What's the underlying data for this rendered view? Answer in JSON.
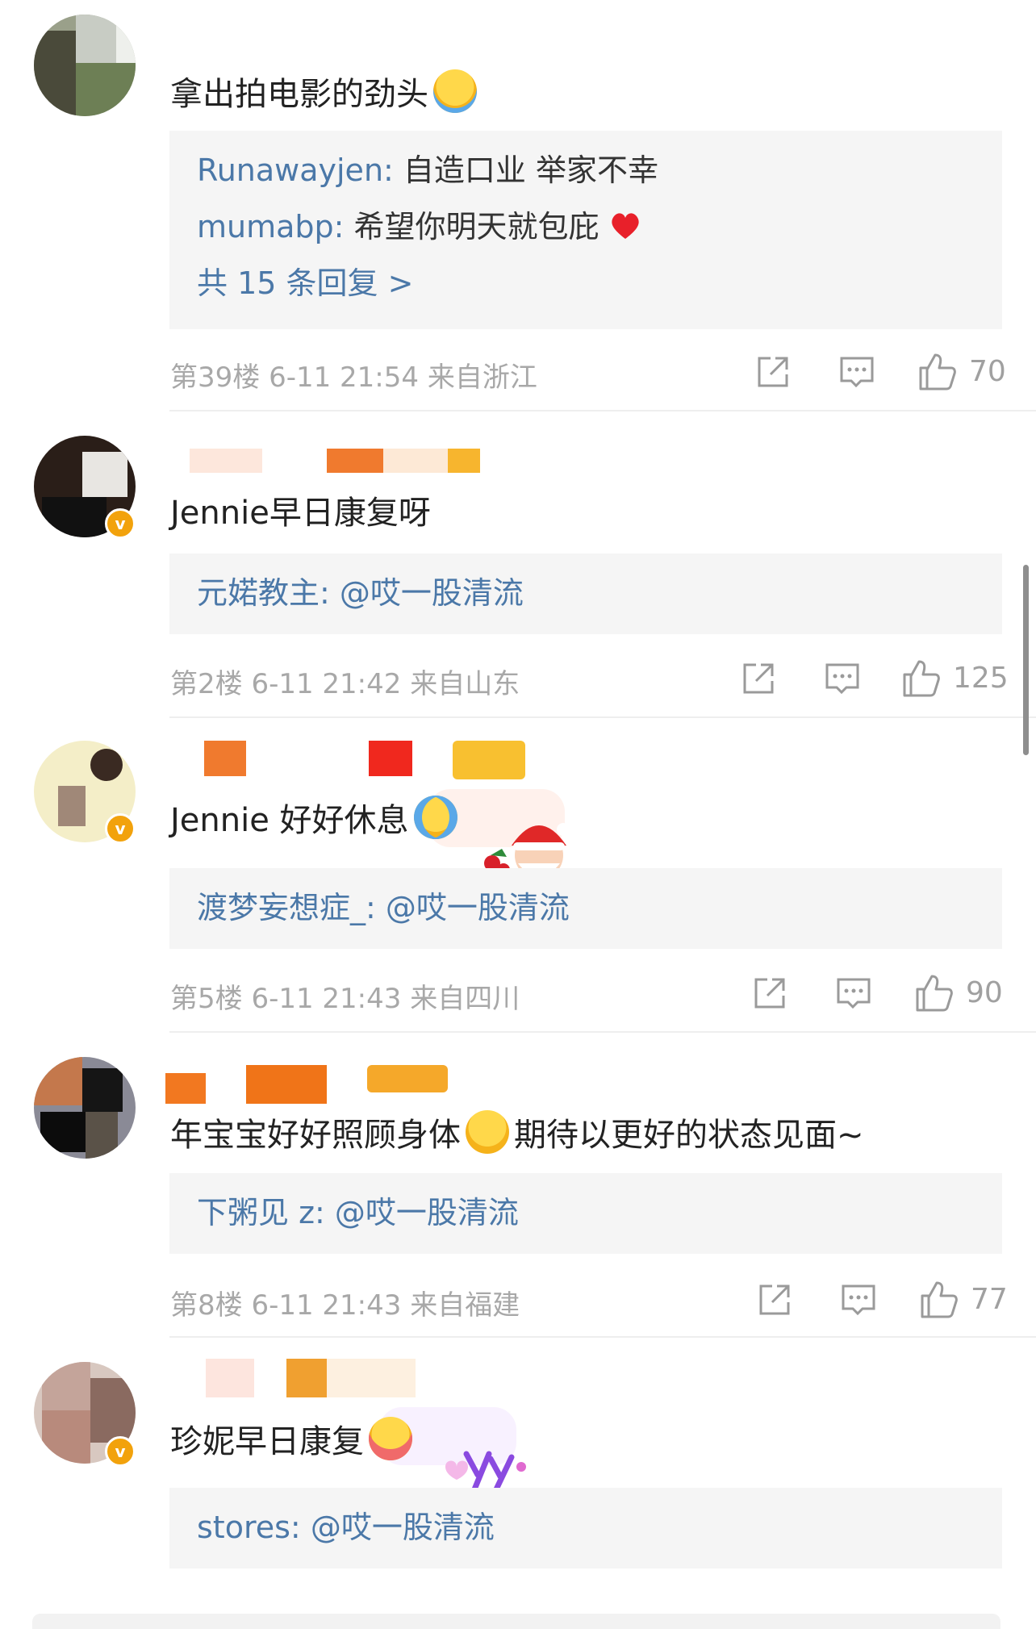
{
  "comments": [
    {
      "text": "拿出拍电影的劲头",
      "emoji": "laughing-tears-emoji",
      "verified": false,
      "replies": [
        {
          "user": "Runawayjen",
          "text": "自造口业 举家不幸"
        },
        {
          "user": "mumabp",
          "text": "希望你明天就包庇"
        }
      ],
      "more": "共 15 条回复 >",
      "meta": "第39楼 6-11 21:54 来自浙江",
      "likes": "70"
    },
    {
      "text": "Jennie早日康复呀",
      "verified": true,
      "replies": [
        {
          "user": "元婼教主",
          "text": "@哎一股清流"
        }
      ],
      "meta": "第2楼 6-11 21:42 来自山东",
      "likes": "125"
    },
    {
      "text": "Jennie 好好休息",
      "emoji": "crying-emoji",
      "verified": true,
      "replies": [
        {
          "user": "渡梦妄想症_",
          "text": "@哎一股清流"
        }
      ],
      "meta": "第5楼 6-11 21:43 来自四川",
      "likes": "90"
    },
    {
      "text": "年宝宝好好照顾身体",
      "text2": "期待以更好的状态见面~",
      "emoji": "pleading-emoji",
      "verified": false,
      "replies": [
        {
          "user": "下粥见 z",
          "text": "@哎一股清流"
        }
      ],
      "meta": "第8楼 6-11 21:43 来自福建",
      "likes": "77"
    },
    {
      "text": "珍妮早日康复",
      "emoji": "hugging-emoji",
      "verified": true,
      "replies": [
        {
          "user": "stores",
          "text": "@哎一股清流"
        }
      ]
    }
  ],
  "reply_separator": ": ",
  "colors": {
    "link_blue": "#4b78a8",
    "reply_bg": "#f5f5f5",
    "meta_gray": "#a8a8a8",
    "verified_badge": "#f2a20c"
  },
  "icons": {
    "share": "share-icon",
    "comment": "comment-icon",
    "like": "thumbs-up-icon",
    "heart": "heart-icon"
  }
}
